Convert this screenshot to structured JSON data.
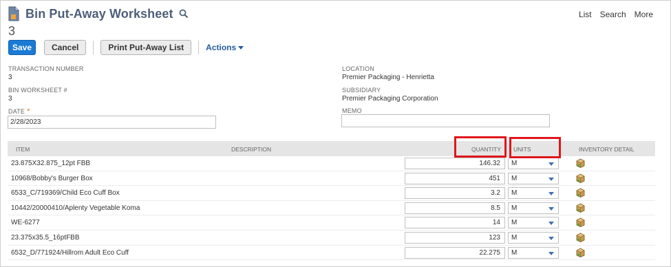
{
  "header": {
    "title": "Bin Put-Away Worksheet",
    "record_number": "3",
    "links": [
      "List",
      "Search",
      "More"
    ]
  },
  "buttons": {
    "save": "Save",
    "cancel": "Cancel",
    "print": "Print Put-Away List",
    "actions": "Actions"
  },
  "fields": {
    "transaction_number": {
      "label": "TRANSACTION NUMBER",
      "value": "3"
    },
    "bin_worksheet": {
      "label": "BIN WORKSHEET #",
      "value": "3"
    },
    "date": {
      "label": "DATE",
      "required_mark": "*",
      "value": "2/28/2023"
    },
    "location": {
      "label": "LOCATION",
      "value": "Premier Packaging - Henrietta"
    },
    "subsidiary": {
      "label": "SUBSIDIARY",
      "value": "Premier Packaging Corporation"
    },
    "memo": {
      "label": "MEMO",
      "value": ""
    }
  },
  "table": {
    "columns": [
      "ITEM",
      "DESCRIPTION",
      "QUANTITY",
      "UNITS",
      "INVENTORY DETAIL"
    ],
    "rows": [
      {
        "item": "23.875X32.875_12pt FBB",
        "description": "",
        "quantity": "146.32",
        "units": "M"
      },
      {
        "item": "10968/Bobby's Burger Box",
        "description": "",
        "quantity": "451",
        "units": "M"
      },
      {
        "item": "6533_C/719369/Child Eco Cuff Box",
        "description": "",
        "quantity": "3.2",
        "units": "M"
      },
      {
        "item": "10442/20000410/Aplenty Vegetable Koma",
        "description": "",
        "quantity": "8.5",
        "units": "M"
      },
      {
        "item": "WE-6277",
        "description": "",
        "quantity": "14",
        "units": "M"
      },
      {
        "item": "23.375x35.5_16ptFBB",
        "description": "",
        "quantity": "123",
        "units": "M"
      },
      {
        "item": "6532_D/771924/Hillrom Adult Eco Cuff",
        "description": "",
        "quantity": "22.275",
        "units": "M"
      }
    ]
  },
  "colors": {
    "title": "#4d5f79",
    "primary_button": "#1a7ad6",
    "link": "#255ba0",
    "highlight_box": "#e0161b",
    "table_header_bg": "#e5e5e5"
  },
  "icons": {
    "record_type": "document-icon",
    "search": "search-icon",
    "inventory_detail": "inventory-box-icon"
  }
}
